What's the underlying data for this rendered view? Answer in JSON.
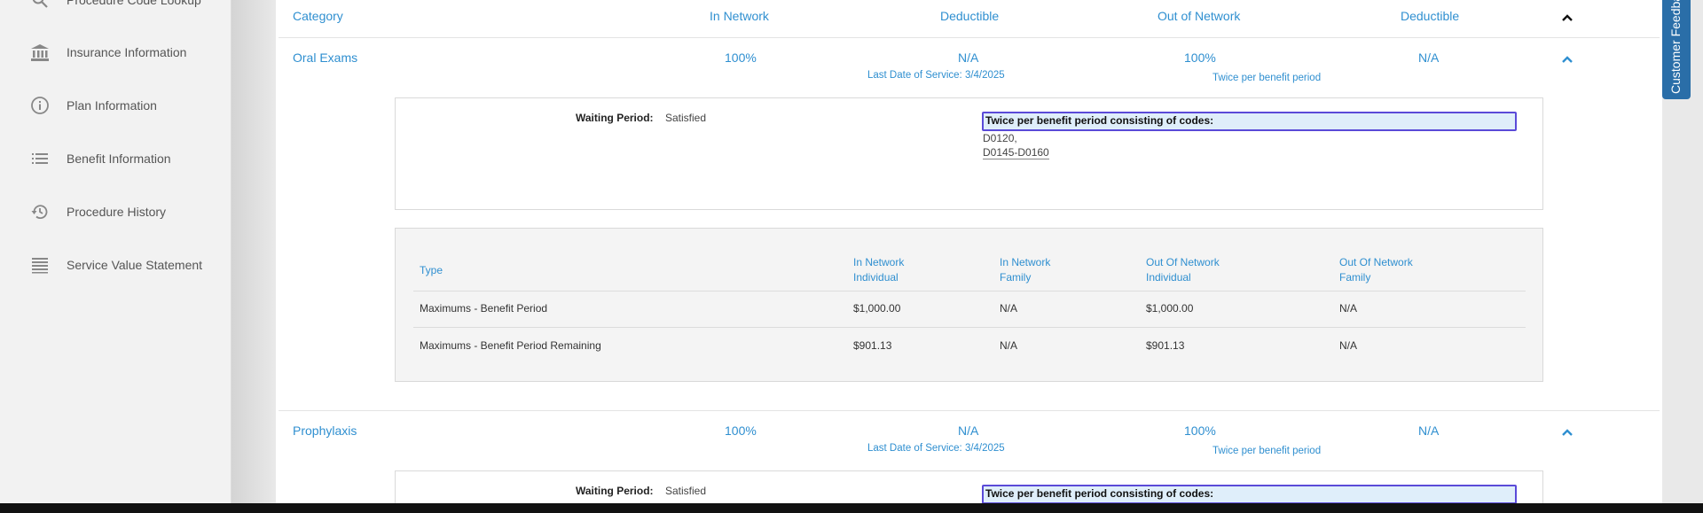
{
  "sidebar": {
    "items": [
      {
        "label": "Procedure Code Lookup",
        "icon": "search-icon"
      },
      {
        "label": "Insurance Information",
        "icon": "bank-icon"
      },
      {
        "label": "Plan Information",
        "icon": "info-icon"
      },
      {
        "label": "Benefit Information",
        "icon": "list-icon"
      },
      {
        "label": "Procedure History",
        "icon": "history-icon"
      },
      {
        "label": "Service Value Statement",
        "icon": "statement-icon"
      }
    ]
  },
  "table_header": {
    "category": "Category",
    "in_network": "In Network",
    "deductible_in": "Deductible",
    "out_network": "Out of Network",
    "deductible_out": "Deductible"
  },
  "rows": [
    {
      "category": "Oral Exams",
      "in_network": "100%",
      "deductible_in": "N/A",
      "out_network": "100%",
      "deductible_out": "N/A",
      "last_service": "Last Date of Service: 3/4/2025",
      "frequency": "Twice per benefit period",
      "waiting_label": "Waiting Period:",
      "waiting_value": "Satisfied",
      "freq_detail": "Twice per benefit period consisting of codes:",
      "codes": [
        "D0120,",
        "D0145-D0160"
      ],
      "max_table": {
        "headers": {
          "type": "Type",
          "in_ind_1": "In Network",
          "in_ind_2": "Individual",
          "in_fam_1": "In Network",
          "in_fam_2": "Family",
          "out_ind_1": "Out Of Network",
          "out_ind_2": "Individual",
          "out_fam_1": "Out Of Network",
          "out_fam_2": "Family"
        },
        "rows": [
          {
            "type": "Maximums - Benefit Period",
            "in_ind": "$1,000.00",
            "in_fam": "N/A",
            "out_ind": "$1,000.00",
            "out_fam": "N/A"
          },
          {
            "type": "Maximums - Benefit Period Remaining",
            "in_ind": "$901.13",
            "in_fam": "N/A",
            "out_ind": "$901.13",
            "out_fam": "N/A"
          }
        ]
      }
    },
    {
      "category": "Prophylaxis",
      "in_network": "100%",
      "deductible_in": "N/A",
      "out_network": "100%",
      "deductible_out": "N/A",
      "last_service": "Last Date of Service: 3/4/2025",
      "frequency": "Twice per benefit period",
      "waiting_label": "Waiting Period:",
      "waiting_value": "Satisfied",
      "freq_detail": "Twice per benefit period consisting of codes:"
    }
  ],
  "feedback_tab": {
    "label": "Customer Feedback"
  },
  "colors": {
    "accent": "#2f8fd0",
    "focus": "#5a4ad8",
    "feedback": "#2a6ea8"
  }
}
